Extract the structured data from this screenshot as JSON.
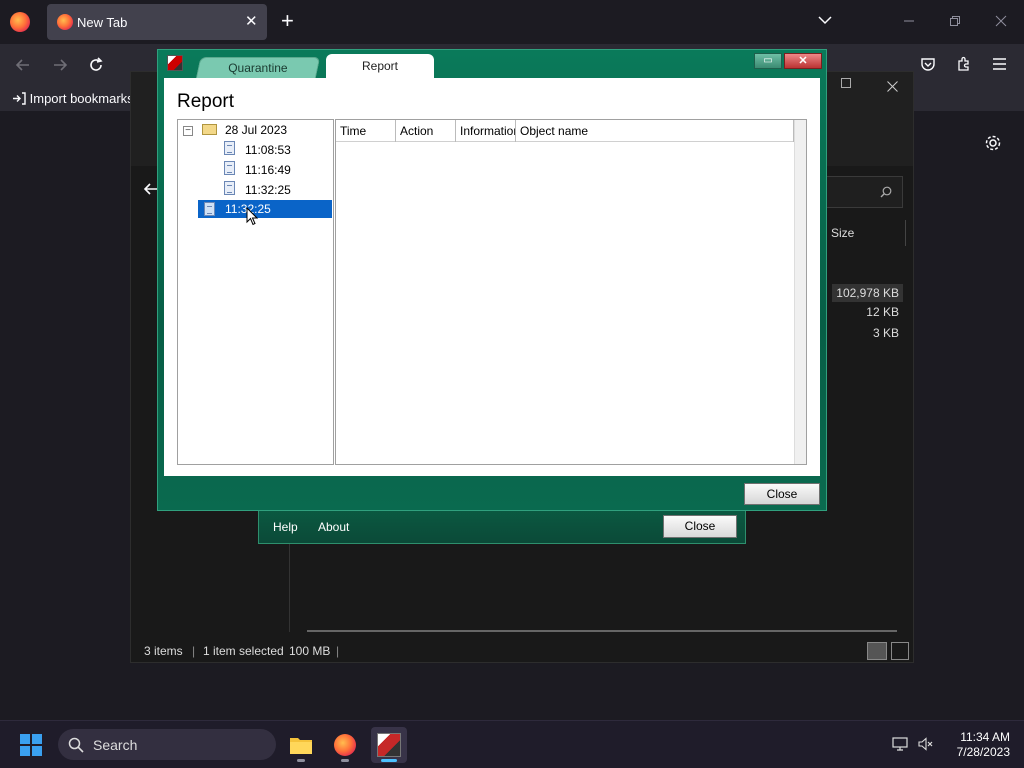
{
  "browser": {
    "tab_title": "New Tab",
    "tab_close": "✕",
    "new_tab": "+",
    "bookmarks": {
      "import_label": "Import bookmarks"
    }
  },
  "explorer": {
    "size_header": "Size",
    "rows": [
      "102,978 KB",
      "12 KB",
      "3 KB"
    ],
    "status": {
      "items": "3 items",
      "selected": "1 item selected",
      "size": "100 MB",
      "sep": "|"
    }
  },
  "kav_main": {
    "help": "Help",
    "about": "About",
    "close": "Close"
  },
  "report_dialog": {
    "tabs": {
      "quarantine": "Quarantine",
      "report": "Report"
    },
    "min_btn": "▭",
    "close_btn": "✕",
    "heading": "Report",
    "tree": {
      "expander": "−",
      "date": "28 Jul 2023",
      "times": [
        "11:08:53",
        "11:16:49",
        "11:32:25"
      ],
      "selected": "11:32:25"
    },
    "columns": [
      "Time",
      "Action",
      "Information",
      "Object name"
    ],
    "close_button": "Close"
  },
  "taskbar": {
    "search_placeholder": "Search",
    "clock_time": "11:34 AM",
    "clock_date": "7/28/2023"
  },
  "colors": {
    "kaspersky_green": "#0a7a5a",
    "selection_blue": "#0a64c8",
    "accent": "#4cc2ff"
  }
}
